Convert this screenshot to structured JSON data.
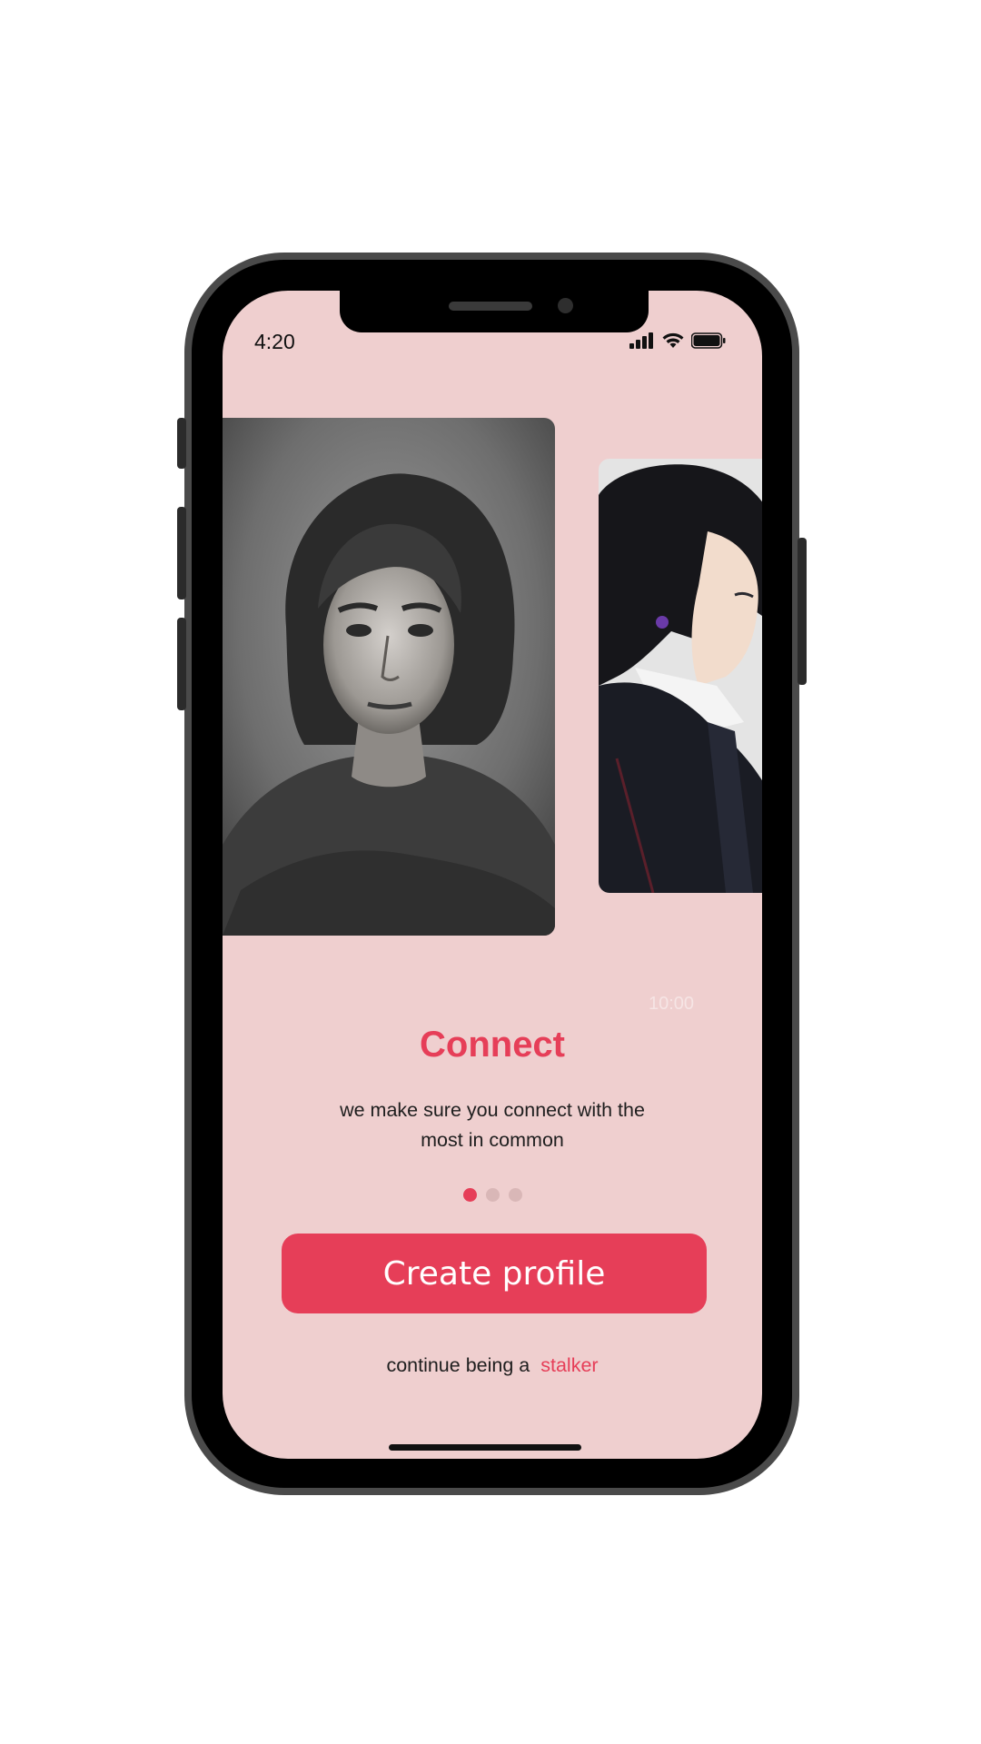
{
  "status_bar": {
    "time": "4:20",
    "icons": [
      "signal-icon",
      "wifi-icon",
      "battery-icon"
    ]
  },
  "carousel": {
    "cards": [
      {
        "name": "charcoal-portrait-woman",
        "kind": "image"
      },
      {
        "name": "anime-portrait-profile",
        "kind": "image"
      }
    ],
    "ghost_time": "10:00",
    "dots_total": 3,
    "active_dot": 0
  },
  "onboarding": {
    "title": "Connect",
    "subtitle": "we make sure you connect with the most in common"
  },
  "cta": {
    "label": "Create profile"
  },
  "footer": {
    "text": "continue being a",
    "link": "stalker"
  },
  "colors": {
    "accent": "#e63e58",
    "background": "#efcfcf",
    "dot_inactive": "#d9b7b7"
  }
}
